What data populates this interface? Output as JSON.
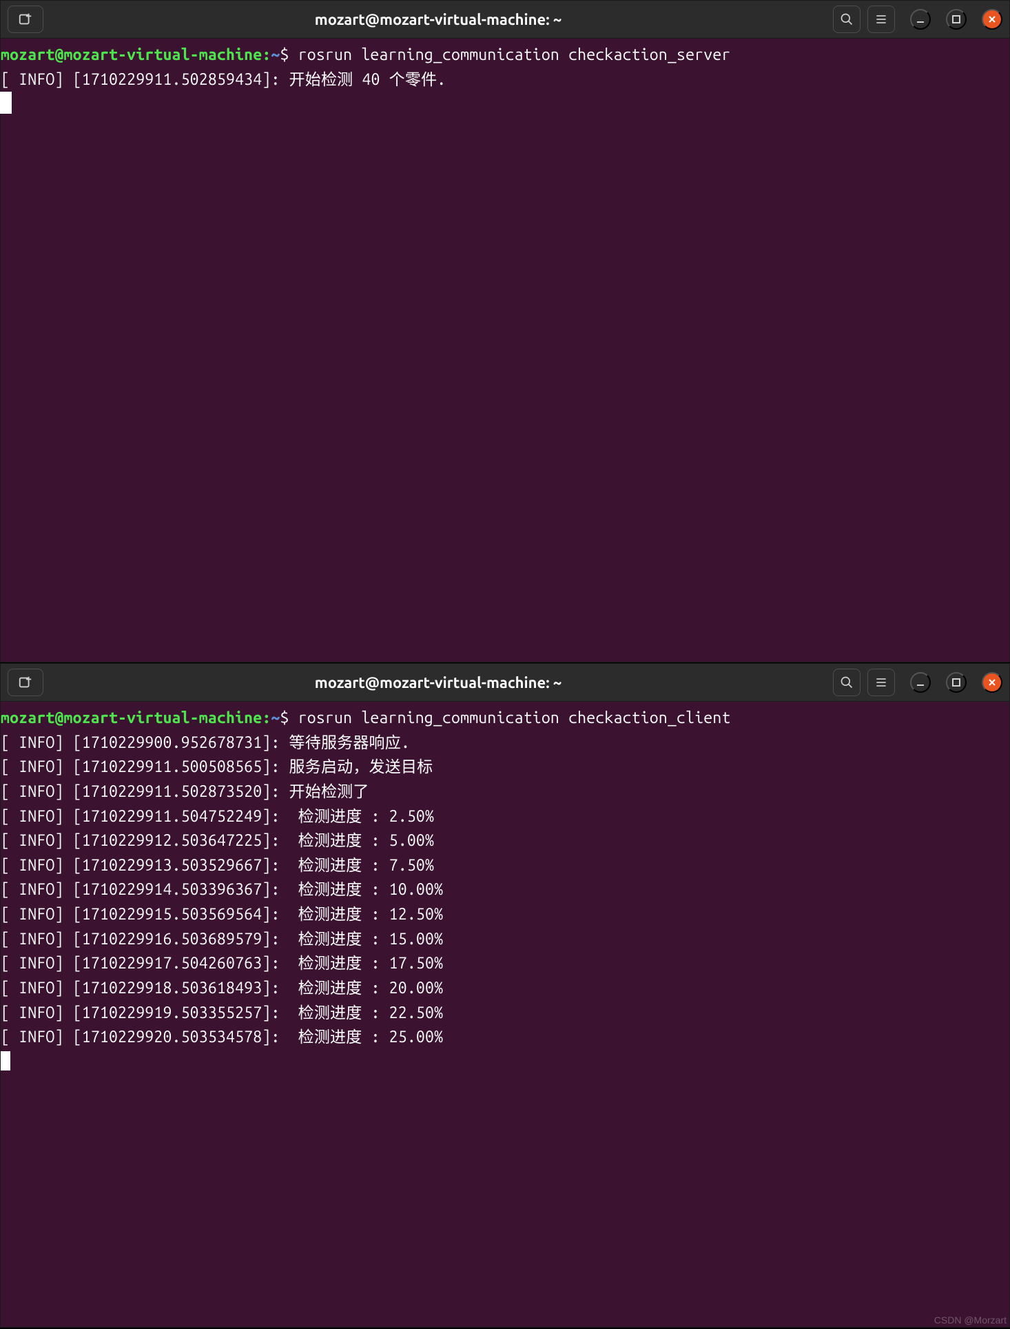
{
  "window1": {
    "title": "mozart@mozart-virtual-machine: ~",
    "prompt_user": "mozart@mozart-virtual-machine",
    "prompt_sep": ":",
    "prompt_path": "~",
    "prompt_end": "$ ",
    "command": "rosrun learning_communication checkaction_server",
    "output_lines": [
      "[ INFO] [1710229911.502859434]: 开始检测 40 个零件."
    ]
  },
  "window2": {
    "title": "mozart@mozart-virtual-machine: ~",
    "prompt_user": "mozart@mozart-virtual-machine",
    "prompt_sep": ":",
    "prompt_path": "~",
    "prompt_end": "$ ",
    "command": "rosrun learning_communication checkaction_client",
    "output_lines": [
      "[ INFO] [1710229900.952678731]: 等待服务器响应.",
      "[ INFO] [1710229911.500508565]: 服务启动，发送目标",
      "[ INFO] [1710229911.502873520]: 开始检测了",
      "[ INFO] [1710229911.504752249]:  检测进度 : 2.50%",
      "[ INFO] [1710229912.503647225]:  检测进度 : 5.00%",
      "[ INFO] [1710229913.503529667]:  检测进度 : 7.50%",
      "[ INFO] [1710229914.503396367]:  检测进度 : 10.00%",
      "[ INFO] [1710229915.503569564]:  检测进度 : 12.50%",
      "[ INFO] [1710229916.503689579]:  检测进度 : 15.00%",
      "[ INFO] [1710229917.504260763]:  检测进度 : 17.50%",
      "[ INFO] [1710229918.503618493]:  检测进度 : 20.00%",
      "[ INFO] [1710229919.503355257]:  检测进度 : 22.50%",
      "[ INFO] [1710229920.503534578]:  检测进度 : 25.00%"
    ]
  },
  "watermark": "CSDN @Morzart"
}
